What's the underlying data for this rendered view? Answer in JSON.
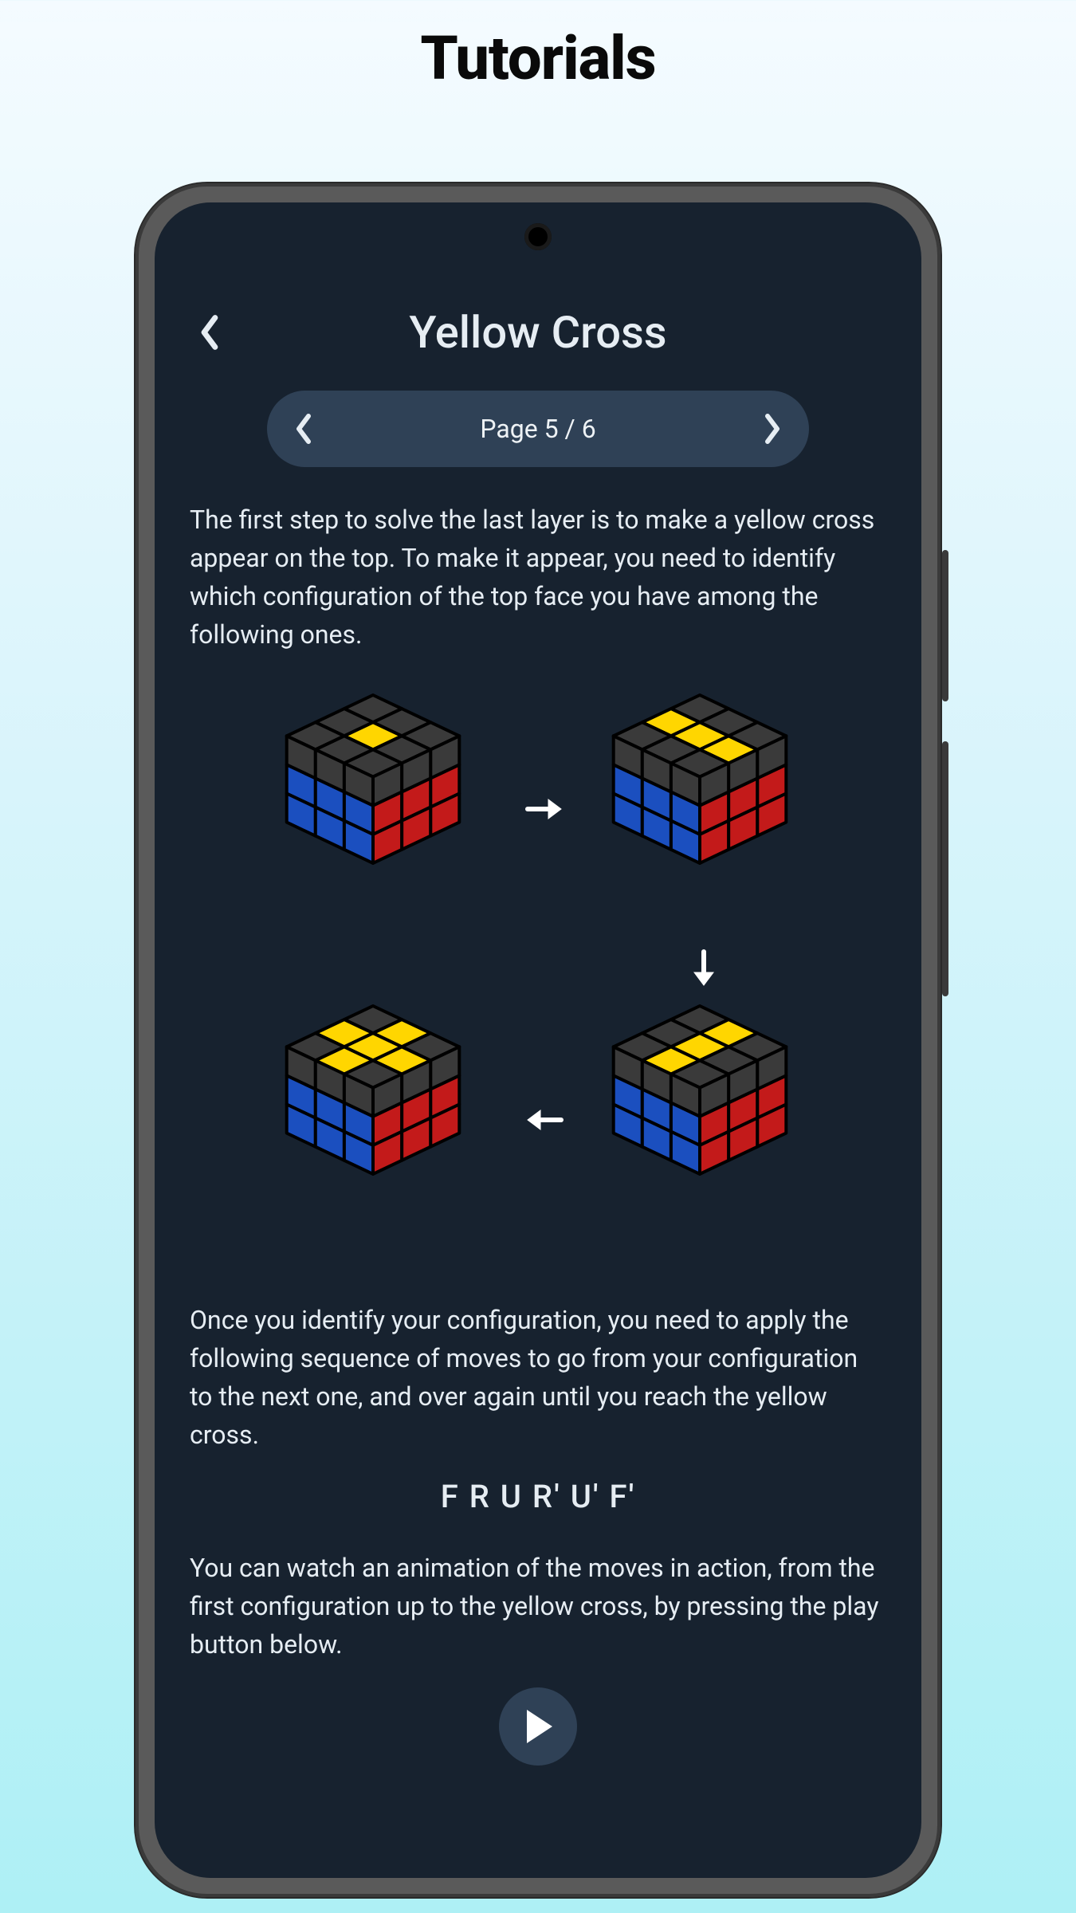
{
  "page_heading": "Tutorials",
  "app": {
    "title": "Yellow Cross",
    "pager_label": "Page 5 / 6",
    "paragraph1": "The first step to solve the last layer is to make a yellow cross appear on the top. To make it appear, you need to identify which configuration of the top face you have among the following ones.",
    "paragraph2": "Once you identify your configuration, you need to apply the following sequence of moves to go from your configuration to the next one, and over again until you reach the yellow cross.",
    "algorithm": "F R U R' U' F'",
    "paragraph3": "You can watch an animation of the moves in action, from the first configuration up to the yellow cross, by pressing the play button below."
  },
  "colors": {
    "screen_bg": "#17222f",
    "pill_bg": "#2f4156",
    "cube_yellow": "#ffd600",
    "cube_blue": "#1b4fbf",
    "cube_red": "#c31a1a",
    "cube_dark": "#3a3a3a"
  },
  "cubes": {
    "tl_top": [
      "d",
      "d",
      "d",
      "d",
      "y",
      "d",
      "d",
      "d",
      "d"
    ],
    "tr_top": [
      "d",
      "d",
      "d",
      "y",
      "y",
      "y",
      "d",
      "d",
      "d"
    ],
    "br_top": [
      "d",
      "y",
      "d",
      "d",
      "y",
      "d",
      "d",
      "y",
      "d"
    ],
    "bl_top": [
      "d",
      "y",
      "d",
      "y",
      "y",
      "y",
      "d",
      "y",
      "d"
    ]
  }
}
